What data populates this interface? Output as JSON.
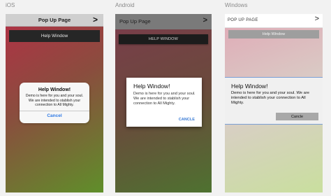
{
  "platforms": {
    "ios": {
      "label": "iOS",
      "nav_title": "Pop Up Page",
      "nav_chevron": ">",
      "help_button": "Help Window",
      "alert": {
        "title": "Help Window!",
        "message": "Demo is here for you and your soul. We are intended to stablish your connection to All Mighty.",
        "button": "Cancel"
      }
    },
    "android": {
      "label": "Android",
      "toolbar_title": "Pop Up Page",
      "toolbar_chevron": ">",
      "help_button": "HELP WINDOW",
      "dialog": {
        "title": "Help Window!",
        "message": "Demo is here for you and your soul. We are intended to stablish your connection to All Mighty.",
        "button": "CANCLE"
      }
    },
    "windows": {
      "label": "Windows",
      "title": "POP UP PAGE",
      "chevron": ">",
      "help_button": "Help Window",
      "dialog": {
        "title": "Help Window!",
        "message": "Demo is here for you and your soul. We are intended to stablish your connection to All Mighty.",
        "button": "Cancle"
      }
    }
  }
}
